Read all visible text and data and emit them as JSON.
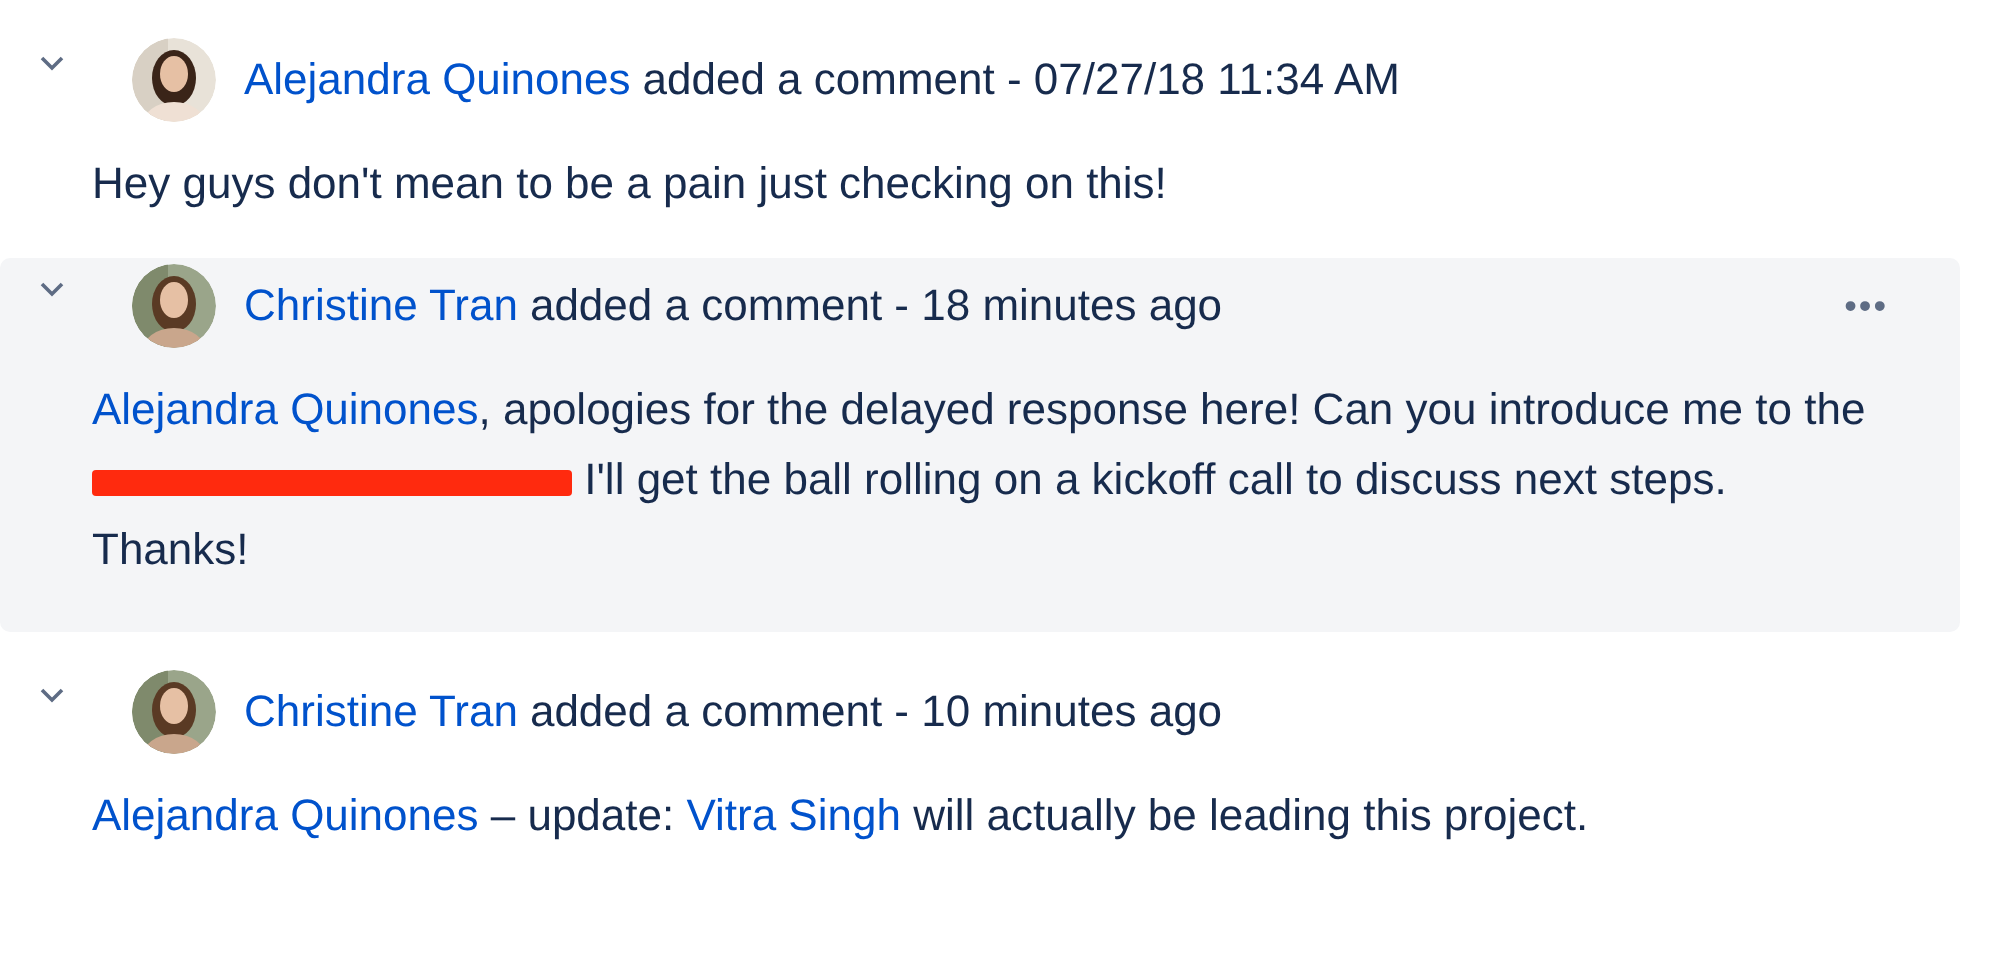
{
  "comments": [
    {
      "expanded": true,
      "highlighted": false,
      "author": "Alejandra Quinones",
      "action": "added a comment - 07/27/18 11:34 AM",
      "body": [
        {
          "kind": "text",
          "text": "Hey guys don't mean to be a pain just checking on this!"
        }
      ]
    },
    {
      "expanded": true,
      "highlighted": true,
      "author": "Christine Tran",
      "action": "added a comment - 18 minutes ago",
      "more": "•••",
      "body": [
        {
          "kind": "mention",
          "text": "Alejandra Quinones"
        },
        {
          "kind": "text",
          "text": ", apologies for the delayed response here! Can you introduce me to the "
        },
        {
          "kind": "redaction"
        },
        {
          "kind": "text",
          "text": " I'll get the ball rolling on a kickoff call to discuss next steps. Thanks!"
        }
      ]
    },
    {
      "expanded": true,
      "highlighted": false,
      "author": "Christine Tran",
      "action": "added a comment - 10 minutes ago",
      "body": [
        {
          "kind": "mention",
          "text": "Alejandra Quinones"
        },
        {
          "kind": "text",
          "text": " – update: "
        },
        {
          "kind": "mention",
          "text": "Vitra Singh"
        },
        {
          "kind": "text",
          "text": " will actually be leading this project."
        }
      ]
    }
  ]
}
